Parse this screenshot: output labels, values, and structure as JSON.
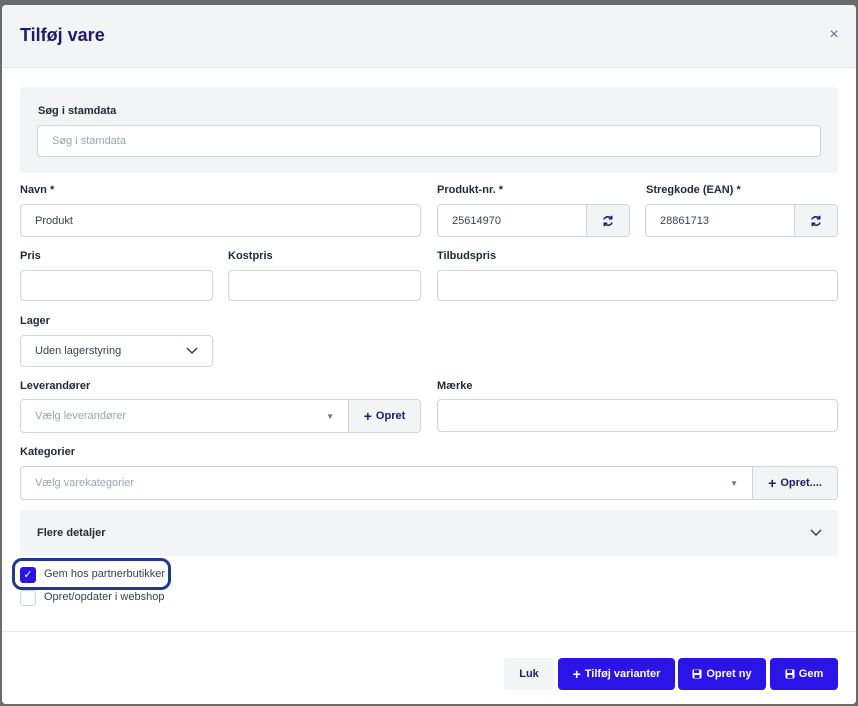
{
  "modal": {
    "title": "Tilføj vare",
    "close_icon": "×"
  },
  "search": {
    "label": "Søg i stamdata",
    "placeholder": "Søg i stamdata"
  },
  "fields": {
    "navn": {
      "label": "Navn *",
      "value": "Produkt"
    },
    "produkt_nr": {
      "label": "Produkt-nr. *",
      "value": "25614970"
    },
    "stregkode": {
      "label": "Stregkode (EAN) *",
      "value": "28861713"
    },
    "pris": {
      "label": "Pris",
      "value": ""
    },
    "kostpris": {
      "label": "Kostpris",
      "value": ""
    },
    "tilbudspris": {
      "label": "Tilbudspris",
      "value": ""
    },
    "lager": {
      "label": "Lager",
      "value": "Uden lagerstyring"
    },
    "leverandorer": {
      "label": "Leverandører",
      "placeholder": "Vælg leverandører",
      "create_label": "Opret"
    },
    "maerke": {
      "label": "Mærke",
      "value": ""
    },
    "kategorier": {
      "label": "Kategorier",
      "placeholder": "Vælg varekategorier",
      "create_label": "Opret...."
    }
  },
  "details": {
    "label": "Flere detaljer"
  },
  "checkboxes": [
    {
      "label": "Gem hos partnerbutikker",
      "checked": true
    },
    {
      "label": "Opret/opdater i webshop",
      "checked": false
    }
  ],
  "footer": {
    "close_label": "Luk",
    "add_variants_label": "Tilføj varianter",
    "create_new_label": "Opret ny",
    "save_label": "Gem"
  },
  "colors": {
    "primary": "#2b14e8",
    "title": "#1e1b6b",
    "highlight": "#1e3a8a"
  }
}
